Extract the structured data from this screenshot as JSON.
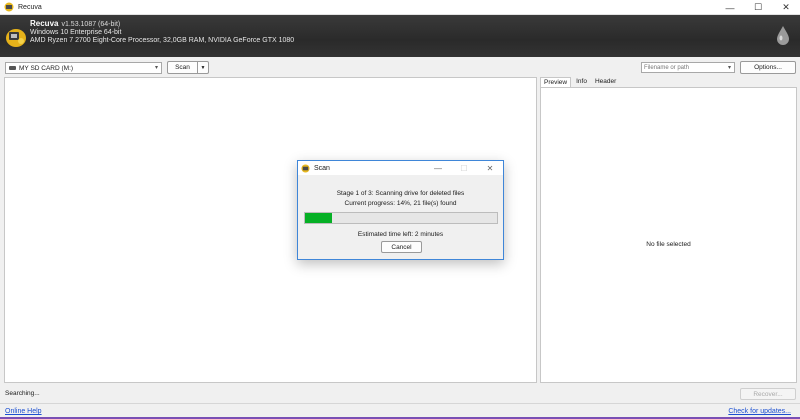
{
  "window": {
    "title": "Recuva",
    "controls": {
      "minimize": "—",
      "maximize": "☐",
      "close": "✕"
    }
  },
  "header": {
    "app_name": "Recuva",
    "version": "v1.53.1087 (64-bit)",
    "os": "Windows 10 Enterprise 64-bit",
    "hardware": "AMD Ryzen 7 2700 Eight-Core Processor, 32,0GB RAM, NVIDIA GeForce GTX 1080"
  },
  "toolbar": {
    "drive": "MY SD CARD (M:)",
    "scan_label": "Scan",
    "filter_placeholder": "Filename or path",
    "options_label": "Options..."
  },
  "right_pane": {
    "tabs": [
      "Preview",
      "Info",
      "Header"
    ],
    "active_tab": "Preview",
    "empty_message": "No file selected"
  },
  "status": {
    "text": "Searching...",
    "recover_label": "Recover...",
    "help_link": "Online Help",
    "update_link": "Check for updates..."
  },
  "dialog": {
    "title": "Scan",
    "stage_text": "Stage 1 of 3: Scanning drive for deleted files",
    "progress_text": "Current progress: 14%, 21 file(s) found",
    "progress_value": 0.14,
    "time_left": "Estimated time left: 2 minutes",
    "cancel_label": "Cancel"
  },
  "colors": {
    "progress": "#06b025",
    "link": "#1b4fd1",
    "dialog_border": "#3f86d8"
  }
}
